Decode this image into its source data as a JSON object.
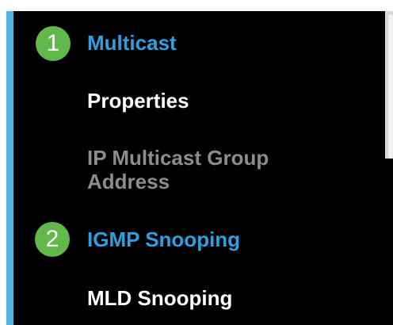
{
  "nav": {
    "accent_color": "#4fb5e3",
    "items": [
      {
        "label": "Multicast",
        "state": "section-active",
        "color": "#2f9fe0"
      },
      {
        "label": "Properties",
        "state": "normal",
        "color": "#ffffff"
      },
      {
        "label": "IP Multicast Group Address",
        "state": "disabled",
        "color": "#8c8c8c"
      },
      {
        "label": "IGMP Snooping",
        "state": "highlighted",
        "color": "#2f9fe0"
      },
      {
        "label": "MLD Snooping",
        "state": "normal",
        "color": "#ffffff"
      }
    ]
  },
  "callouts": [
    {
      "number": "1",
      "color": "#62b84a"
    },
    {
      "number": "2",
      "color": "#62b84a"
    }
  ]
}
